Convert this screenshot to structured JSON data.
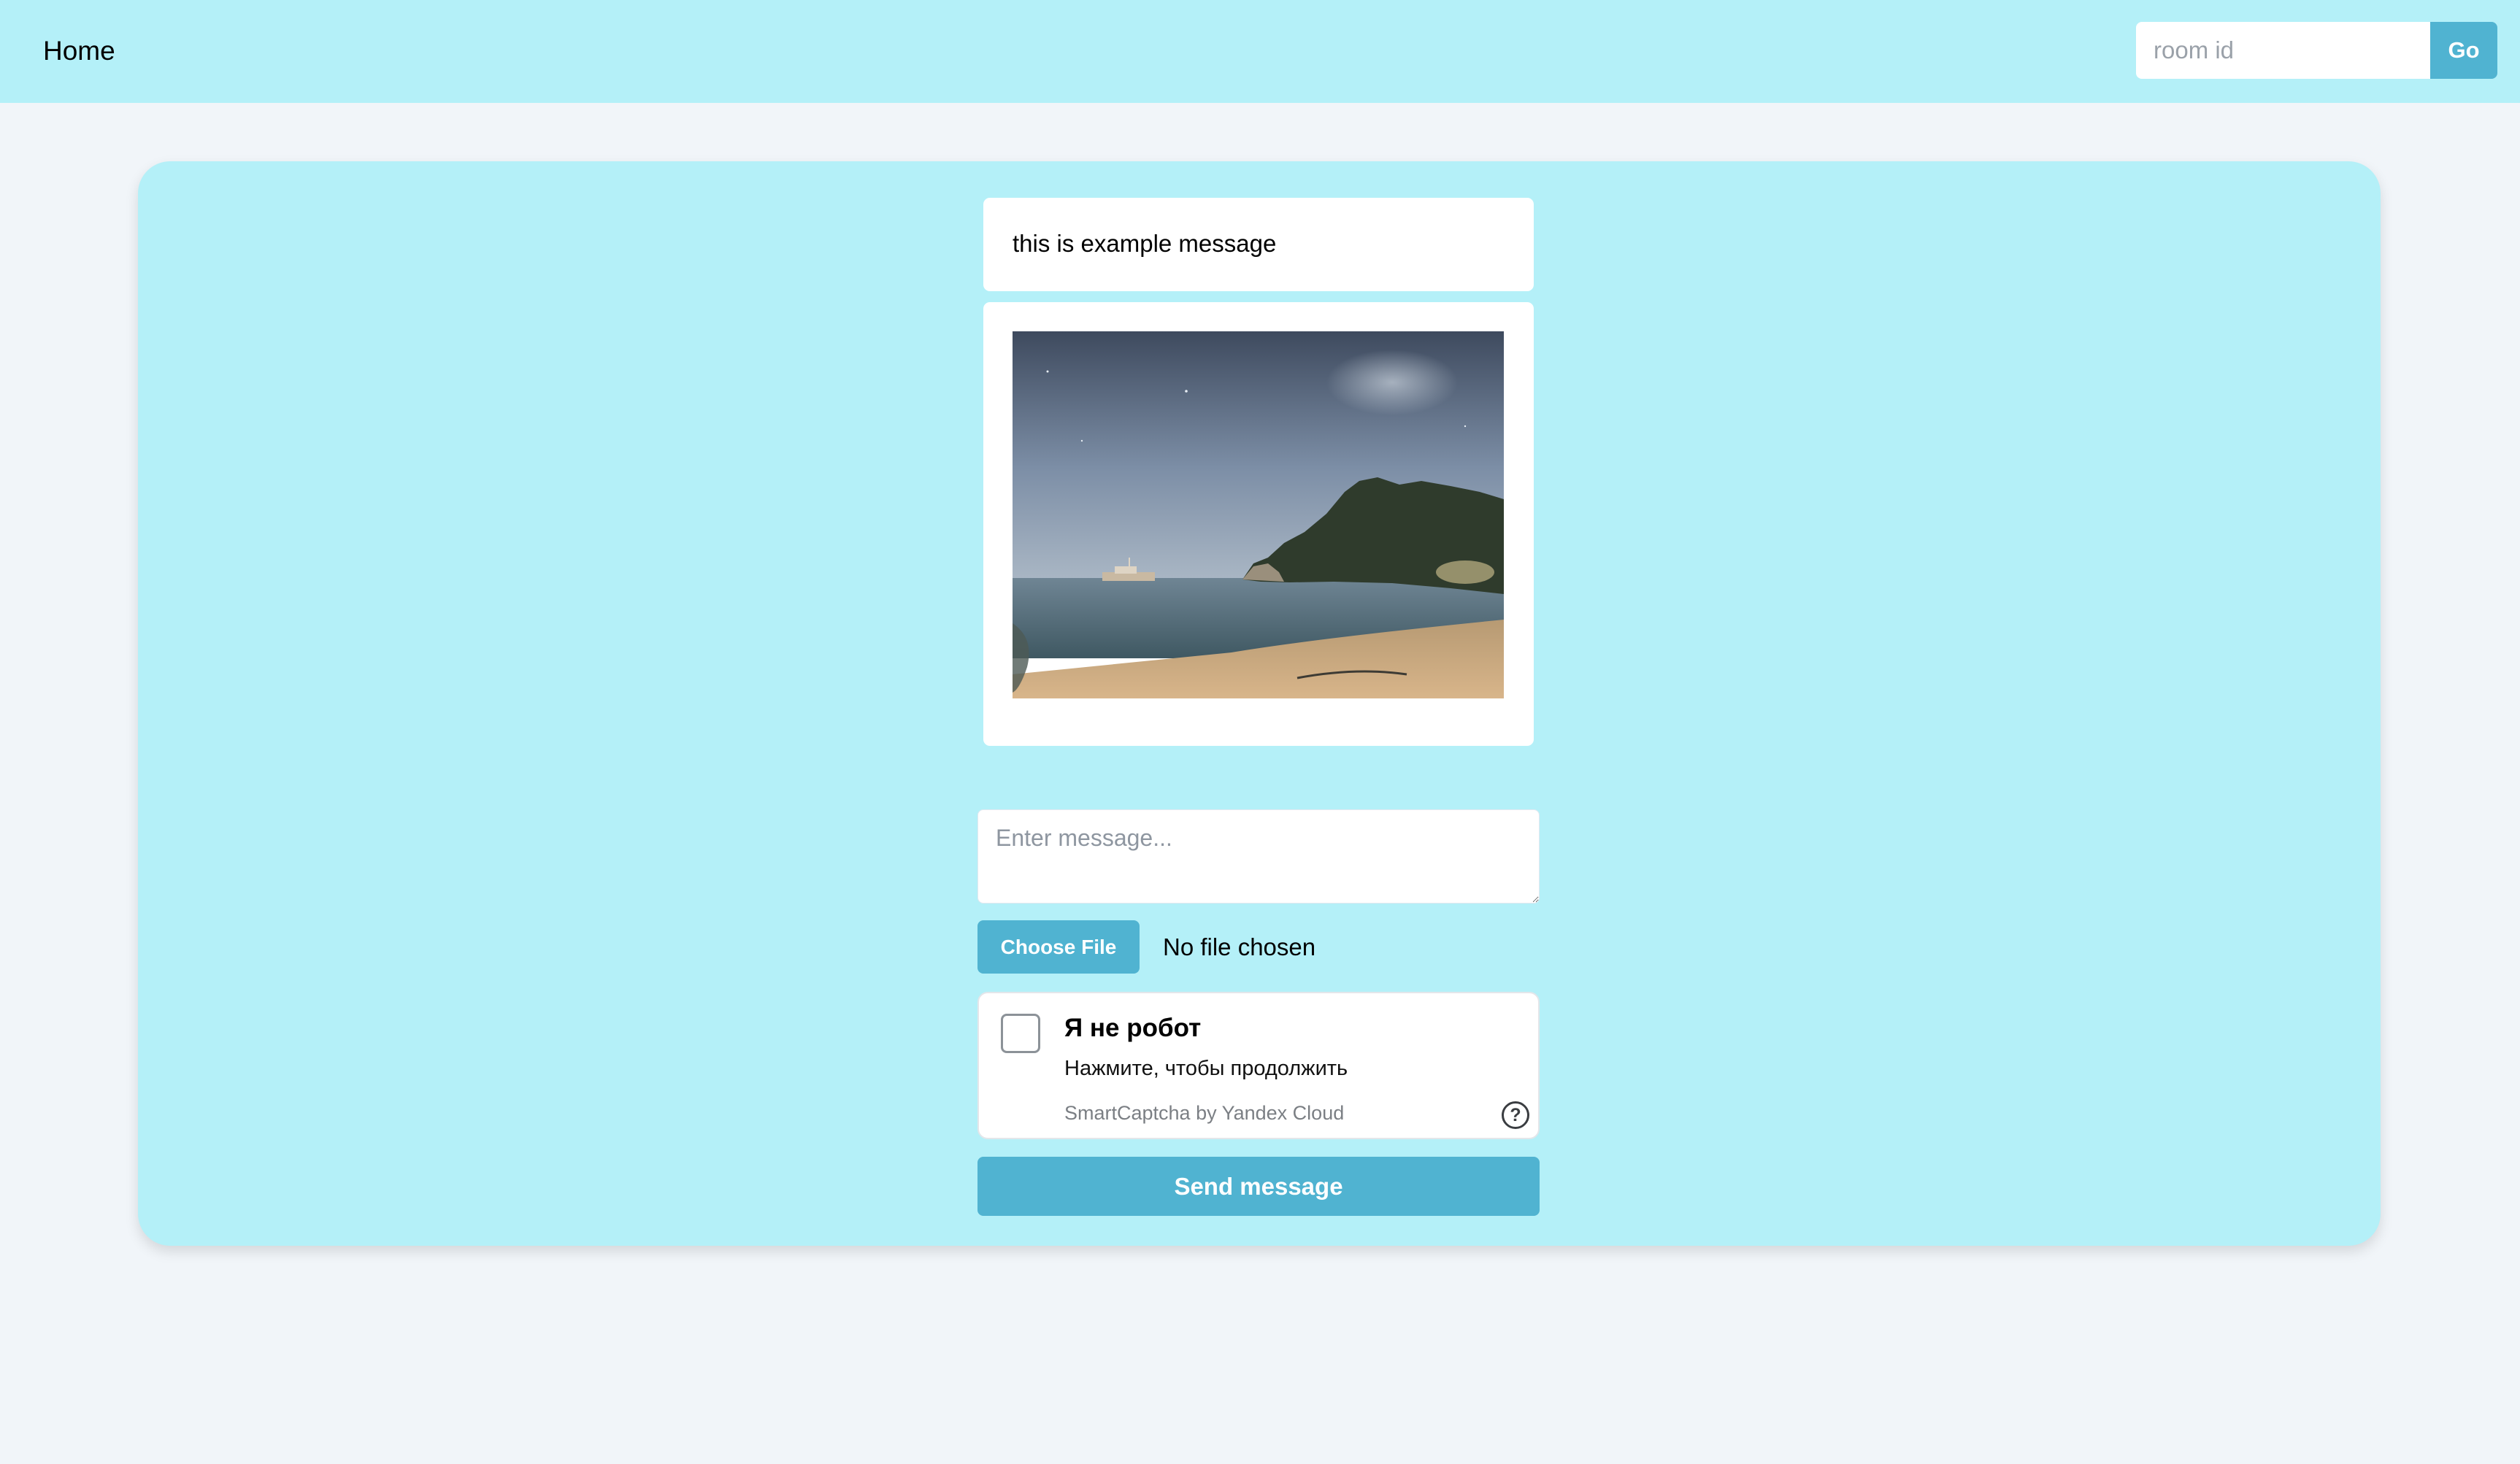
{
  "header": {
    "home_label": "Home",
    "room_placeholder": "room id",
    "go_label": "Go"
  },
  "messages": {
    "text": "this is example message"
  },
  "composer": {
    "message_placeholder": "Enter message...",
    "choose_file_label": "Choose File",
    "file_status": "No file chosen",
    "send_label": "Send message"
  },
  "captcha": {
    "title": "Я не робот",
    "subtitle": "Нажмите, чтобы продолжить",
    "brand": "SmartCaptcha by Yandex Cloud",
    "help_glyph": "?"
  },
  "colors": {
    "background": "#f1f5f9",
    "panel": "#b4f0f8",
    "accent": "#50b3d1"
  },
  "icons": {
    "captcha_help": "question-circle-icon"
  }
}
